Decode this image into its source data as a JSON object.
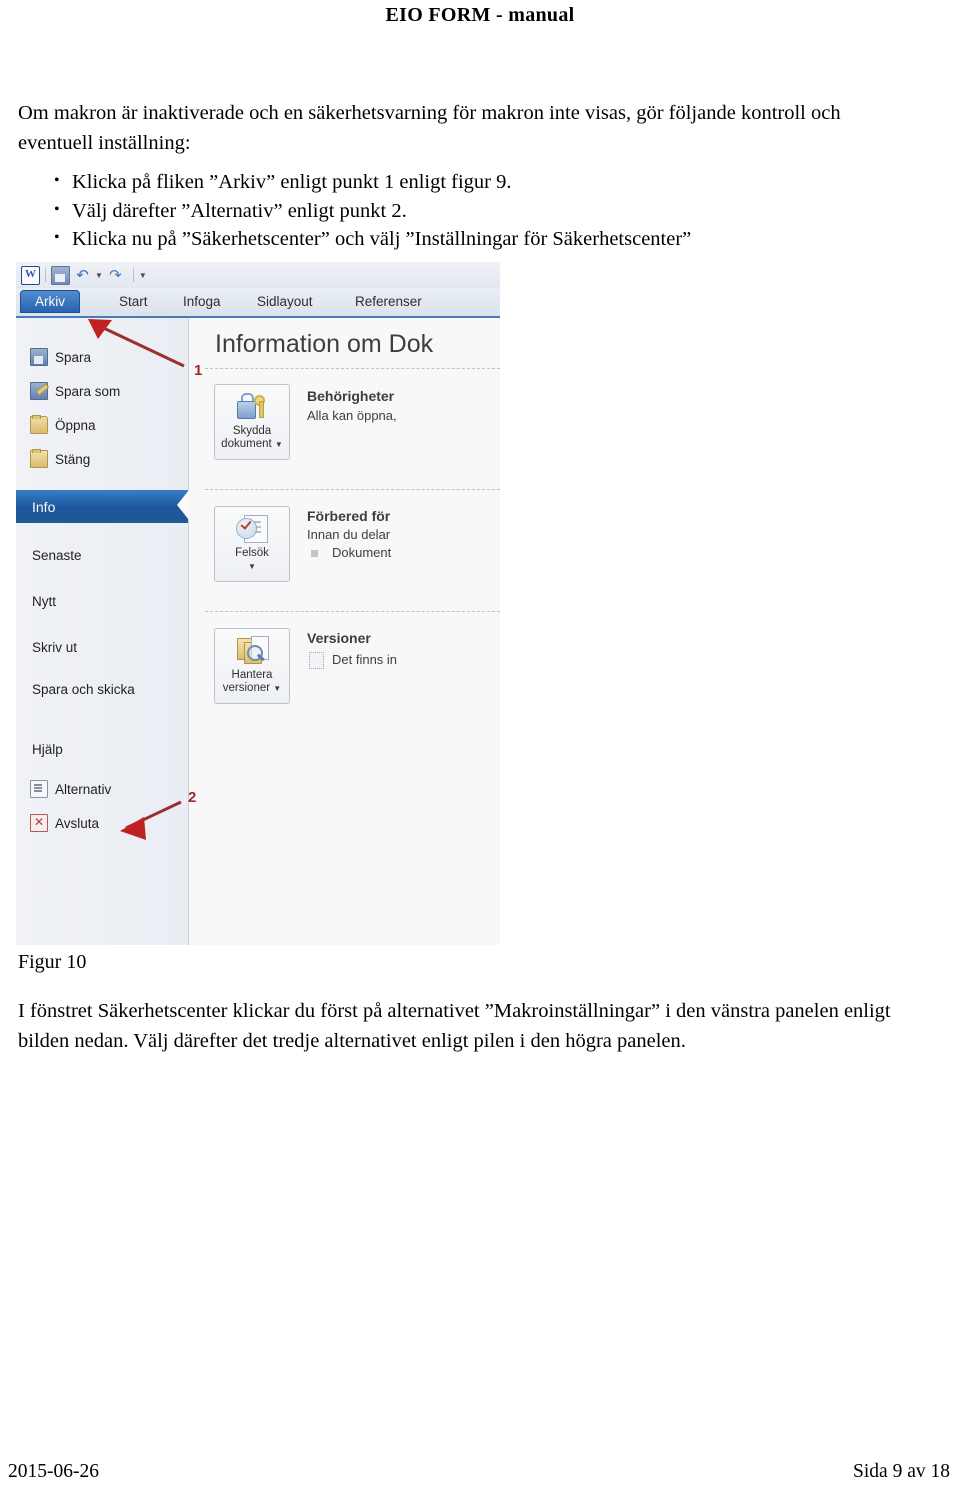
{
  "document": {
    "header_title": "EIO FORM - manual",
    "intro_paragraph": "Om makron är inaktiverade och en säkerhetsvarning för makron inte visas, gör följande kontroll och eventuell inställning:",
    "bullets": [
      "Klicka på fliken ”Arkiv” enligt punkt 1 enligt figur 9.",
      "Välj därefter ”Alternativ” enligt punkt 2.",
      "Klicka nu på ”Säkerhetscenter” och välj ”Inställningar för Säkerhetscenter”"
    ],
    "figure_caption": "Figur 10",
    "closing_paragraph": "I fönstret Säkerhetscenter klickar du först på alternativet ”Makroinställningar” i den vänstra panelen enligt bilden nedan. Välj därefter det tredje alternativet enligt pilen i den högra panelen.",
    "footer": {
      "date": "2015-06-26",
      "page": "Sida 9 av 18"
    }
  },
  "screenshot": {
    "app_logo": "W",
    "quick_access": {
      "save_icon": "save-icon",
      "undo_icon": "undo-icon",
      "redo_icon": "redo-icon",
      "more_icon": "chevron-down-icon"
    },
    "ribbon_tabs": [
      {
        "label": "Arkiv",
        "active": true
      },
      {
        "label": "Start",
        "active": false
      },
      {
        "label": "Infoga",
        "active": false
      },
      {
        "label": "Sidlayout",
        "active": false
      },
      {
        "label": "Referenser",
        "active": false
      }
    ],
    "backstage_nav": [
      {
        "label": "Spara",
        "icon": "floppy-disk-icon",
        "selected": false
      },
      {
        "label": "Spara som",
        "icon": "floppy-disk-pencil-icon",
        "selected": false
      },
      {
        "label": "Öppna",
        "icon": "open-folder-icon",
        "selected": false
      },
      {
        "label": "Stäng",
        "icon": "folder-icon",
        "selected": false
      },
      {
        "label": "Info",
        "icon": "",
        "selected": true
      },
      {
        "label": "Senaste",
        "icon": "",
        "selected": false
      },
      {
        "label": "Nytt",
        "icon": "",
        "selected": false
      },
      {
        "label": "Skriv ut",
        "icon": "",
        "selected": false
      },
      {
        "label": "Spara och skicka",
        "icon": "",
        "selected": false
      },
      {
        "label": "Hjälp",
        "icon": "",
        "selected": false
      },
      {
        "label": "Alternativ",
        "icon": "options-icon",
        "selected": false
      },
      {
        "label": "Avsluta",
        "icon": "exit-icon",
        "selected": false
      }
    ],
    "info_pane": {
      "title": "Information om Dok",
      "sections": [
        {
          "button_label_line1": "Skydda",
          "button_label_line2": "dokument",
          "button_icon": "lock-key-icon",
          "heading": "Behörigheter",
          "body": "Alla kan öppna,",
          "sub": ""
        },
        {
          "button_label_line1": "Felsök",
          "button_label_line2": "",
          "button_icon": "document-check-icon",
          "heading": "Förbered för",
          "body": "Innan du delar",
          "sub": "Dokument"
        },
        {
          "button_label_line1": "Hantera",
          "button_label_line2": "versioner",
          "button_icon": "versions-icon",
          "heading": "Versioner",
          "body": "Det finns in",
          "sub": ""
        }
      ]
    },
    "callouts": [
      {
        "number": "1",
        "target": "Arkiv tab"
      },
      {
        "number": "2",
        "target": "Alternativ"
      }
    ],
    "colors": {
      "accent_blue": "#1f63b8",
      "selected_blue": "#1354a4",
      "callout_red": "#b01f24"
    }
  }
}
